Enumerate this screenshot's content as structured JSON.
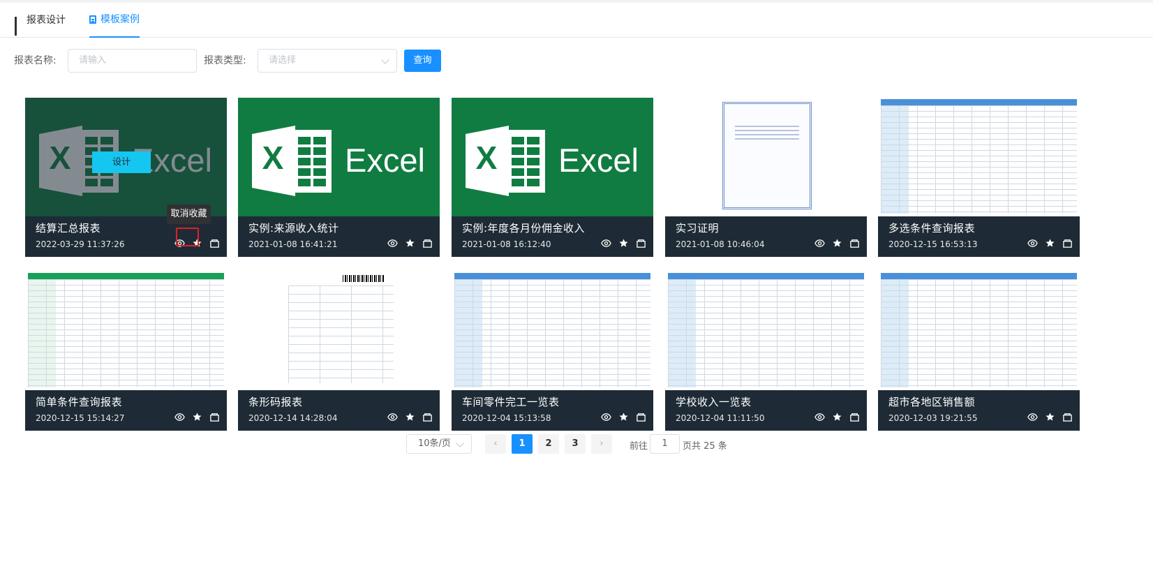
{
  "tabs": [
    {
      "label": "报表设计",
      "icon": "grid-icon",
      "active": false
    },
    {
      "label": "模板案例",
      "icon": "document-icon",
      "active": true
    }
  ],
  "search": {
    "name_label": "报表名称:",
    "name_placeholder": "请输入",
    "type_label": "报表类型:",
    "type_placeholder": "请选择",
    "query_label": "查询"
  },
  "cards": [
    {
      "title": "结算汇总报表",
      "date": "2022-03-29 11:37:26",
      "thumb": "excel",
      "hovered": true
    },
    {
      "title": "实例:来源收入统计",
      "date": "2021-01-08 16:41:21",
      "thumb": "excel"
    },
    {
      "title": "实例:年度各月份佣金收入",
      "date": "2021-01-08 16:12:40",
      "thumb": "excel"
    },
    {
      "title": "实习证明",
      "date": "2021-01-08 10:46:04",
      "thumb": "certificate"
    },
    {
      "title": "多选条件查询报表",
      "date": "2020-12-15 16:53:13",
      "thumb": "table-blue"
    },
    {
      "title": "简单条件查询报表",
      "date": "2020-12-15 15:14:27",
      "thumb": "table-green"
    },
    {
      "title": "条形码报表",
      "date": "2020-12-14 14:28:04",
      "thumb": "form"
    },
    {
      "title": "车间零件完工一览表",
      "date": "2020-12-04 15:13:58",
      "thumb": "table-blue"
    },
    {
      "title": "学校收入一览表",
      "date": "2020-12-04 11:11:50",
      "thumb": "table-blue"
    },
    {
      "title": "超市各地区销售额",
      "date": "2020-12-03 19:21:55",
      "thumb": "table-blue"
    }
  ],
  "excel_text": "Excel",
  "hover": {
    "design_label": "设计",
    "tooltip": "取消收藏"
  },
  "pagination": {
    "page_size": "10条/页",
    "pages": [
      "1",
      "2",
      "3"
    ],
    "current": "1",
    "goto_label": "前往",
    "goto_value": "1",
    "total_label": "页共 25 条"
  },
  "colors": {
    "primary": "#1890ff",
    "excel_green": "#107c41",
    "card_footer": "#1e2b36",
    "highlight_red": "#e02020"
  }
}
